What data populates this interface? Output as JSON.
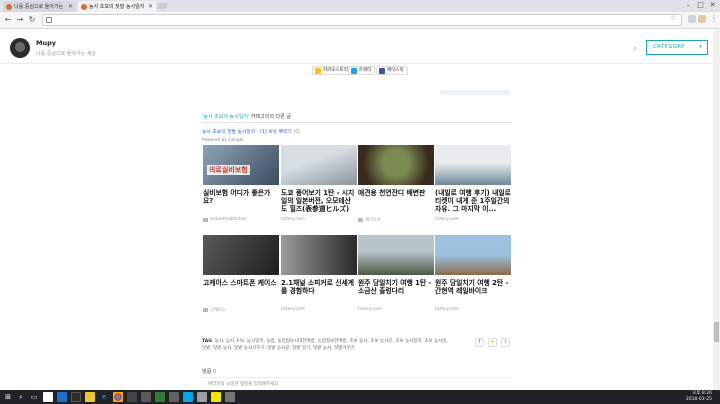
{
  "browser": {
    "tabs": [
      {
        "label": "나를 중심으로 돌아가는",
        "active": false
      },
      {
        "label": "농사 초보의 첫발 농사일지",
        "active": true
      }
    ],
    "address": "",
    "window_controls": {
      "minimize": "–",
      "maximize": "□",
      "close": "✕"
    }
  },
  "blog": {
    "name": "Mupy",
    "description": "나를 중심으로 돌아가는 세상",
    "search_icon": "search-icon",
    "category_label": "CATEGORY"
  },
  "share": [
    {
      "label": "카카오스토리",
      "color": "#f5c518"
    },
    {
      "label": "트위터",
      "color": "#1da1f2"
    },
    {
      "label": "페이스북",
      "color": "#3b5998"
    }
  ],
  "related": {
    "category_name": "'농사 초보의 농사일지'",
    "suffix": " 카테고리의 다른 글"
  },
  "content_ad": {
    "title": "농사 초보의 첫발 농사일지 - (1) 씨앗 뿌리기",
    "count": " (0)",
    "powered": "Powered by Google"
  },
  "cards": [
    {
      "title": "실비보험 어디가 좋은가요?",
      "source": "ssitummaifection",
      "badge": "의료실비보험",
      "thumb_colors": [
        "#8fa3b8",
        "#3a4b5e"
      ]
    },
    {
      "title": "도쿄 풍어보기 1탄 - 시지일의 일본버전, 오모테산도 힐즈(表参道ヒルズ)",
      "source": "tistory.com",
      "thumb_colors": [
        "#d6dde3",
        "#8a949c"
      ]
    },
    {
      "title": "애견용 천연잔디 배변판",
      "source": "캐나다사",
      "thumb_colors": [
        "#7b8a52",
        "#3a2a1e"
      ]
    },
    {
      "title": "(내일로 여행 후기) 내일로 티켓이 내게 준 1주일간의 자유. 그 마지막 이...",
      "source": "tistory.com",
      "thumb_colors": [
        "#e8ecef",
        "#6f8a9a"
      ]
    },
    {
      "title": "고케이스 스마트폰 케이스",
      "source": "고케이스",
      "thumb_colors": [
        "#5a5a5a",
        "#1e1e1e"
      ]
    },
    {
      "title": "2.1채널 소피커로 신세계를 경험하다",
      "source": "tistory.com",
      "thumb_colors": [
        "#9a9a9a",
        "#2a2a2a"
      ]
    },
    {
      "title": "원주 당일치기 여행 1탄 - 소금산 출렁다리",
      "source": "tistory.com",
      "thumb_colors": [
        "#b8c4cc",
        "#4e5a44"
      ]
    },
    {
      "title": "원주 당일치기 여행 2탄 - 간현역 레일바이크",
      "source": "tistory.com",
      "thumb_colors": [
        "#9cc2e0",
        "#8a6a4a"
      ]
    }
  ],
  "tags": {
    "label": "TAG",
    "text": "농사, 농사 초보, 농사일지, 농업, 농업정보시대한여름, 농업정보한여름, 초보 농사, 초보 농사꾼, 초보 농사일지, 초보 농사일, 텃밭, 텃밭 농사, 텃밭 농사가꾸기, 텃밭 농사꾼, 텃밭 일기, 텃밭 농사, 텃밭가꾸기"
  },
  "tag_buttons": [
    {
      "label": "f",
      "color": "#3b5998"
    },
    {
      "label": "★",
      "color": "#f5c518"
    },
    {
      "label": "t",
      "color": "#1da1f2"
    }
  ],
  "comments": {
    "label": "댓글",
    "count": "0",
    "placeholder": "여러분의 소중한 댓글을 입력해주세요"
  },
  "taskbar": {
    "icons": [
      "windows-icon",
      "search-icon",
      "task-view-icon",
      "edge-icon",
      "explorer-icon",
      "store-icon",
      "chrome-icon",
      "app-icon",
      "app-icon",
      "app-icon",
      "app-icon",
      "app-icon",
      "app-icon",
      "kakaotalk-icon",
      "app-icon",
      "app-icon"
    ],
    "time": "오후 8:26",
    "date": "2018-03-25"
  }
}
